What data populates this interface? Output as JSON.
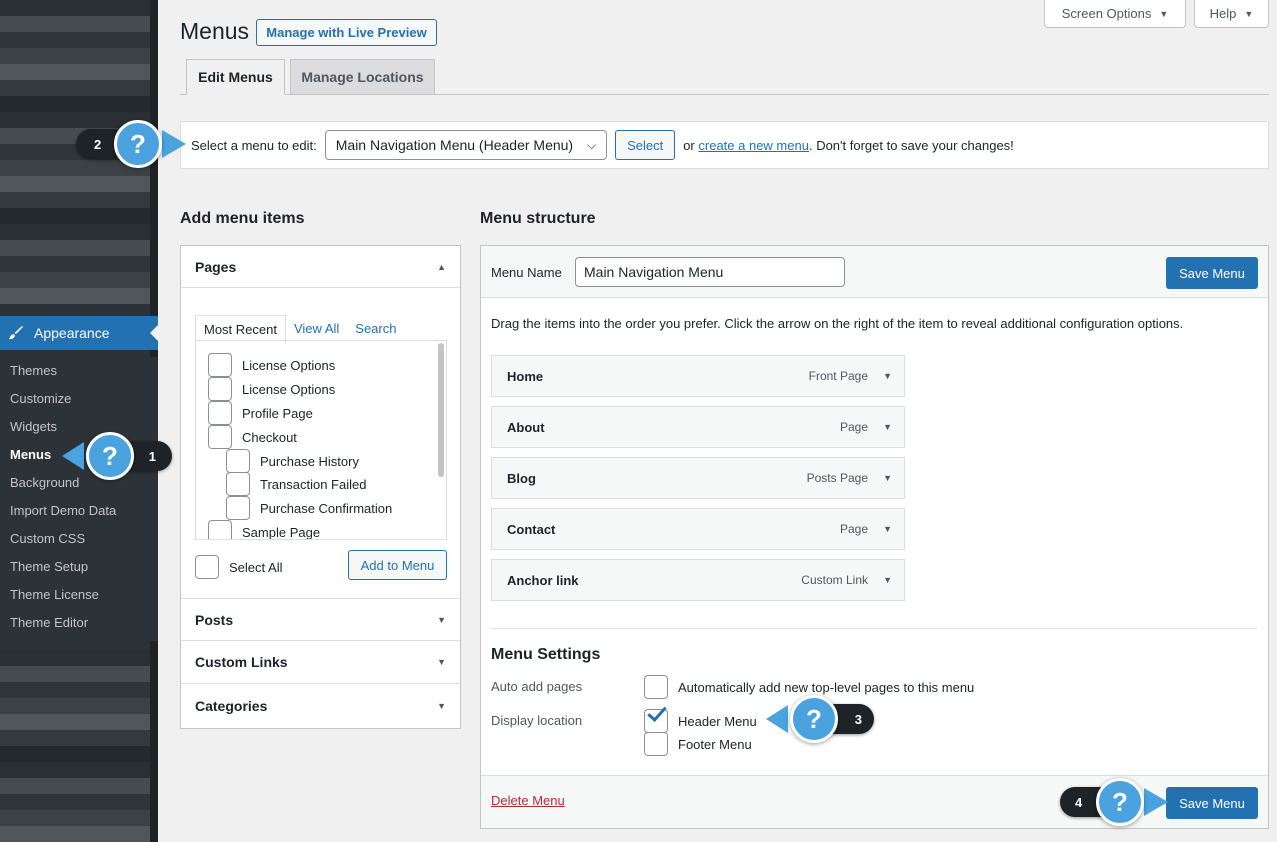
{
  "sidebar": {
    "active_menu": "Appearance",
    "items": [
      "Themes",
      "Customize",
      "Widgets",
      "Menus",
      "Background",
      "Import Demo Data",
      "Custom CSS",
      "Theme Setup",
      "Theme License",
      "Theme Editor"
    ],
    "current_item": "Menus"
  },
  "header": {
    "title": "Menus",
    "live_preview": "Manage with Live Preview",
    "screen_options": "Screen Options",
    "help": "Help"
  },
  "tabs": [
    "Edit Menus",
    "Manage Locations"
  ],
  "select_bar": {
    "label": "Select a menu to edit:",
    "selected": "Main Navigation Menu (Header Menu)",
    "select_button": "Select",
    "or": "or",
    "create_link": "create a new menu",
    "suffix": ". Don't forget to save your changes!"
  },
  "left": {
    "title": "Add menu items",
    "pages_title": "Pages",
    "page_tabs": [
      "Most Recent",
      "View All",
      "Search"
    ],
    "pages": [
      "License Options",
      "License Options",
      "Profile Page",
      "Checkout",
      "Purchase History",
      "Transaction Failed",
      "Purchase Confirmation",
      "Sample Page"
    ],
    "select_all": "Select All",
    "add_to_menu": "Add to Menu",
    "sections": [
      "Posts",
      "Custom Links",
      "Categories"
    ]
  },
  "right": {
    "title": "Menu structure",
    "menu_name_label": "Menu Name",
    "menu_name_value": "Main Navigation Menu",
    "save": "Save Menu",
    "instructions": "Drag the items into the order you prefer. Click the arrow on the right of the item to reveal additional configuration options.",
    "items": [
      {
        "label": "Home",
        "type": "Front Page"
      },
      {
        "label": "About",
        "type": "Page"
      },
      {
        "label": "Blog",
        "type": "Posts Page"
      },
      {
        "label": "Contact",
        "type": "Page"
      },
      {
        "label": "Anchor link",
        "type": "Custom Link"
      }
    ],
    "settings_title": "Menu Settings",
    "auto_add_label": "Auto add pages",
    "auto_add_text": "Automatically add new top-level pages to this menu",
    "display_label": "Display location",
    "locations": [
      {
        "label": "Header Menu",
        "checked": true
      },
      {
        "label": "Footer Menu",
        "checked": false
      }
    ],
    "delete": "Delete Menu"
  },
  "callouts": [
    {
      "number": "1",
      "icon": "?"
    },
    {
      "number": "2",
      "icon": "?"
    },
    {
      "number": "3",
      "icon": "?"
    },
    {
      "number": "4",
      "icon": "?"
    }
  ],
  "colors": {
    "accent": "#2271b1",
    "sidebar": "#2c3338",
    "callout": "#4aa3df",
    "badge": "#1d2327"
  }
}
